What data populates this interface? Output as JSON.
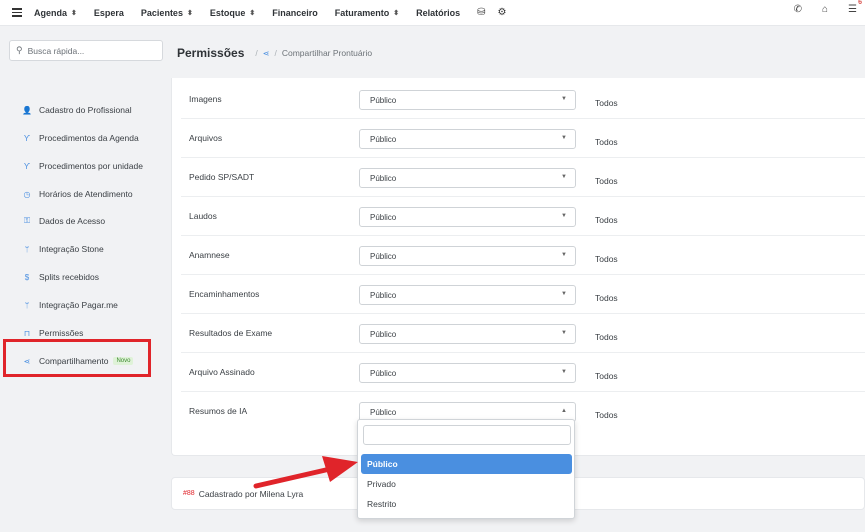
{
  "topbar": {
    "nav": [
      {
        "label": "Agenda",
        "caret": true
      },
      {
        "label": "Espera",
        "caret": false
      },
      {
        "label": "Pacientes",
        "caret": true
      },
      {
        "label": "Estoque",
        "caret": true
      },
      {
        "label": "Financeiro",
        "caret": false
      },
      {
        "label": "Faturamento",
        "caret": true
      },
      {
        "label": "Relatórios",
        "caret": false
      }
    ],
    "notification_count": "6"
  },
  "sidebar": {
    "search_placeholder": "Busca rápida...",
    "items": [
      {
        "label": "Cadastro do Profissional",
        "icon": "user-icon"
      },
      {
        "label": "Procedimentos da Agenda",
        "icon": "stethoscope-icon"
      },
      {
        "label": "Procedimentos por unidade",
        "icon": "stethoscope-icon"
      },
      {
        "label": "Horários de Atendimento",
        "icon": "clock-icon"
      },
      {
        "label": "Dados de Acesso",
        "icon": "key-icon"
      },
      {
        "label": "Integração Stone",
        "icon": "branch-icon"
      },
      {
        "label": "Splits recebidos",
        "icon": "dollar-icon"
      },
      {
        "label": "Integração Pagar.me",
        "icon": "branch-icon"
      },
      {
        "label": "Permissões",
        "icon": "lock-icon"
      },
      {
        "label": "Compartilhamento",
        "icon": "share-icon",
        "badge": "Novo"
      }
    ]
  },
  "header": {
    "title": "Permissões",
    "breadcrumb": "Compartilhar Prontuário"
  },
  "permissions": {
    "rows": [
      {
        "label": "Imagens",
        "value": "Público",
        "scope": "Todos"
      },
      {
        "label": "Arquivos",
        "value": "Público",
        "scope": "Todos"
      },
      {
        "label": "Pedido SP/SADT",
        "value": "Público",
        "scope": "Todos"
      },
      {
        "label": "Laudos",
        "value": "Público",
        "scope": "Todos"
      },
      {
        "label": "Anamnese",
        "value": "Público",
        "scope": "Todos"
      },
      {
        "label": "Encaminhamentos",
        "value": "Público",
        "scope": "Todos"
      },
      {
        "label": "Resultados de Exame",
        "value": "Público",
        "scope": "Todos"
      },
      {
        "label": "Arquivo Assinado",
        "value": "Público",
        "scope": "Todos"
      },
      {
        "label": "Resumos de IA",
        "value": "Público",
        "scope": "Todos"
      }
    ]
  },
  "dropdown": {
    "options": [
      "Público",
      "Privado",
      "Restrito"
    ],
    "selected": "Público"
  },
  "footer": {
    "id_tag": "#88",
    "text": "Cadastrado por Milena Lyra"
  },
  "colors": {
    "accent": "#4a8fe0",
    "highlight": "#e0242a",
    "badge_bg": "#dff2d8"
  }
}
